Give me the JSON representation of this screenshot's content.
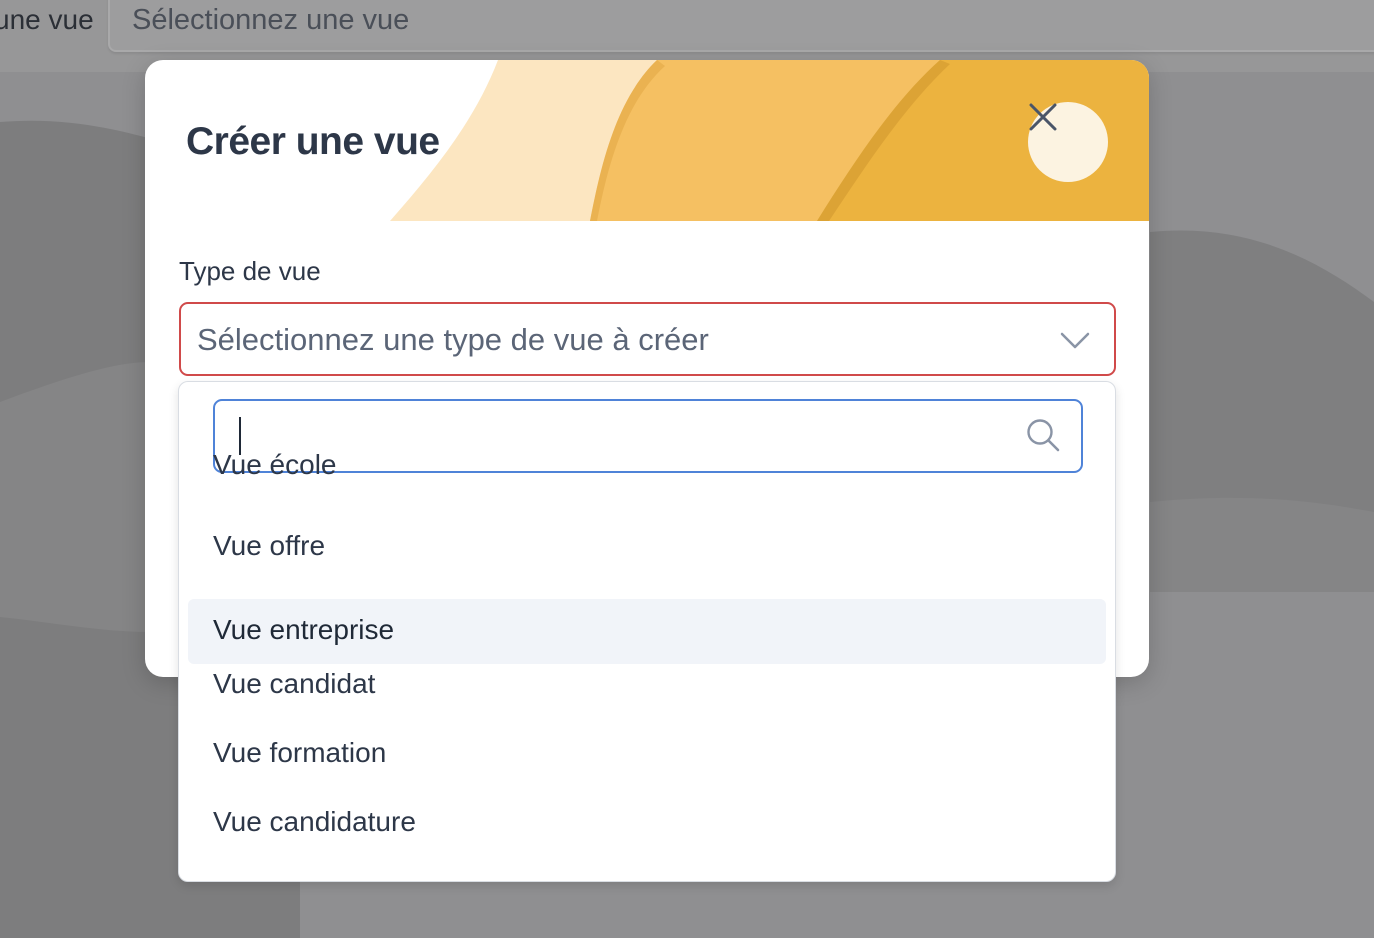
{
  "background": {
    "field_label": "une vue",
    "select_placeholder": "Sélectionnez une vue"
  },
  "modal": {
    "title": "Créer une vue",
    "close_icon": "close-icon",
    "field_label": "Type de vue",
    "select": {
      "placeholder": "Sélectionnez une type de vue à créer",
      "icon": "chevron-down-icon"
    },
    "dropdown": {
      "search": {
        "value": "",
        "icon": "search-icon"
      },
      "options": [
        {
          "label": "Vue école"
        },
        {
          "label": "Vue offre"
        },
        {
          "label": "Vue entreprise",
          "highlighted": true
        },
        {
          "label": "Vue candidat"
        },
        {
          "label": "Vue formation"
        },
        {
          "label": "Vue candidature"
        }
      ]
    }
  },
  "colors": {
    "accent_error": "#d04a4a",
    "focus_border": "#4f83d8",
    "header_gold": "#ecb33f",
    "header_light": "#fce6c1",
    "title_text": "#2d3748"
  }
}
